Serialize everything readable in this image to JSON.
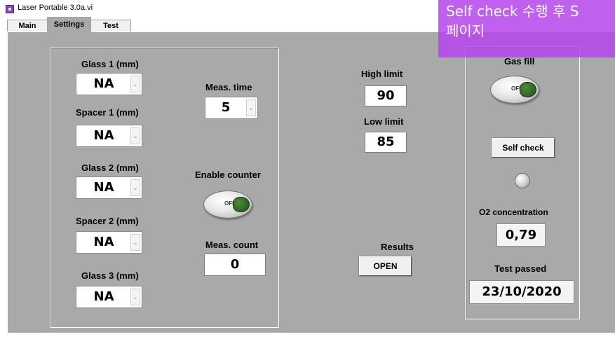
{
  "window": {
    "title": "Laser Portable 3.0a.vi"
  },
  "tabs": [
    "Main",
    "Settings",
    "Test"
  ],
  "settings": {
    "glass1": {
      "label": "Glass 1 (mm)",
      "value": "NA"
    },
    "spacer1": {
      "label": "Spacer 1 (mm)",
      "value": "NA"
    },
    "glass2": {
      "label": "Glass 2 (mm)",
      "value": "NA"
    },
    "spacer2": {
      "label": "Spacer 2 (mm)",
      "value": "NA"
    },
    "glass3": {
      "label": "Glass 3 (mm)",
      "value": "NA"
    },
    "meas_time": {
      "label": "Meas. time",
      "value": "5"
    },
    "enable_counter": {
      "label": "Enable counter",
      "state": "OFF"
    },
    "meas_count": {
      "label": "Meas. count",
      "value": "0"
    },
    "high_limit": {
      "label": "High limit",
      "value": "90"
    },
    "low_limit": {
      "label": "Low limit",
      "value": "85"
    },
    "results": {
      "label": "Results",
      "button": "OPEN"
    }
  },
  "self_check_panel": {
    "gas_fill": {
      "label": "Gas fill",
      "state": "OFF"
    },
    "self_check_button": "Self check",
    "o2": {
      "label": "O2 concentration",
      "value": "0,79"
    },
    "test_passed": {
      "label": "Test passed",
      "value": "23/10/2020"
    }
  },
  "overlay": {
    "line1": "Self check 수행 후 S",
    "line2": "페이지",
    "color": "#b446eb"
  },
  "colors": {
    "panel_bg": "#a9a9a9",
    "toggle_knob": "#2e6b24"
  }
}
